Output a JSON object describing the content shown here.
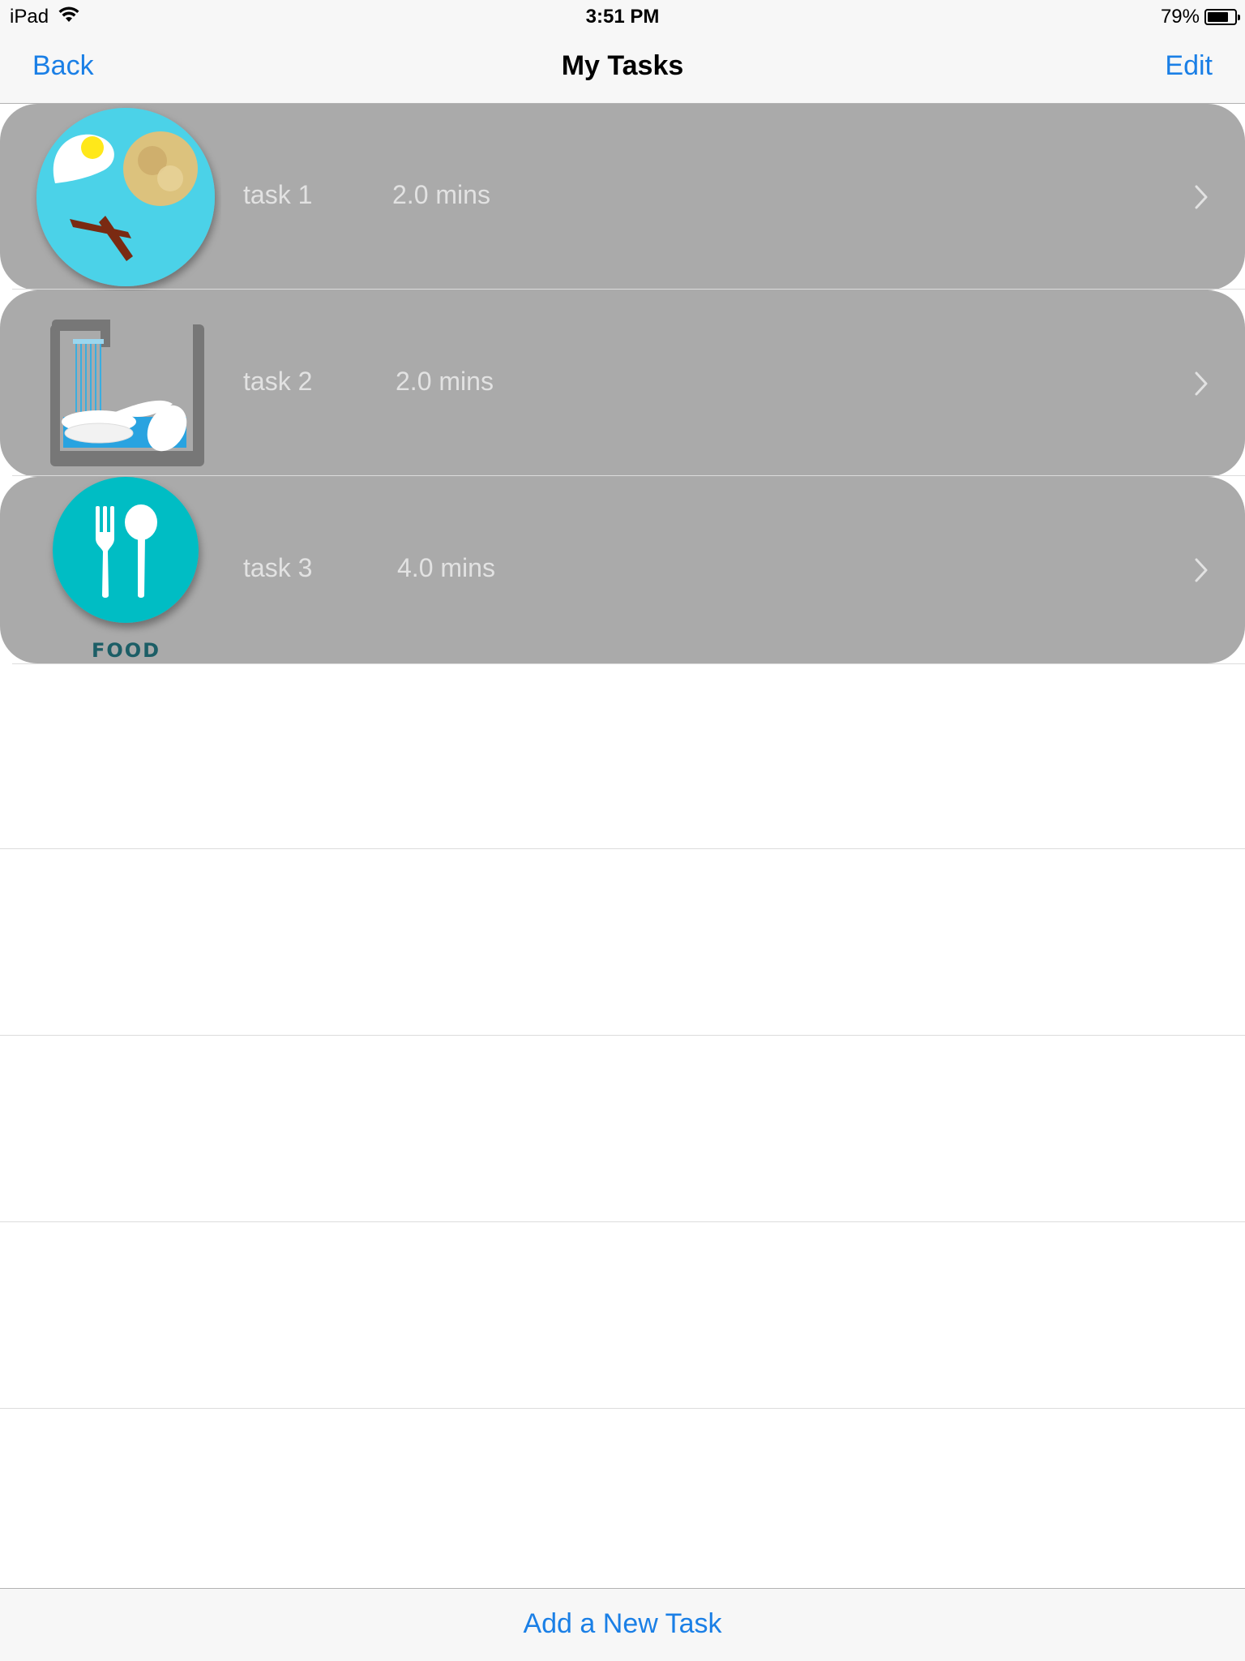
{
  "status_bar": {
    "device": "iPad",
    "time": "3:51 PM",
    "battery_text": "79%",
    "battery_level": 0.79,
    "icons": [
      "wifi-icon",
      "battery-icon"
    ]
  },
  "nav": {
    "back_label": "Back",
    "title": "My Tasks",
    "edit_label": "Edit"
  },
  "tasks": [
    {
      "name": "task 1",
      "duration": "2.0 mins",
      "icon": "breakfast-plate-icon"
    },
    {
      "name": "task 2",
      "duration": "2.0 mins",
      "icon": "dishwashing-sink-icon"
    },
    {
      "name": "task 3",
      "duration": "4.0 mins",
      "icon": "food-utensils-icon",
      "icon_caption": "FOOD"
    }
  ],
  "toolbar": {
    "add_label": "Add a New Task"
  },
  "colors": {
    "accent": "#1a7fe6",
    "row_background": "#aaaaaa",
    "row_text": "#e2e2e2",
    "bar_background": "#f7f7f7"
  }
}
